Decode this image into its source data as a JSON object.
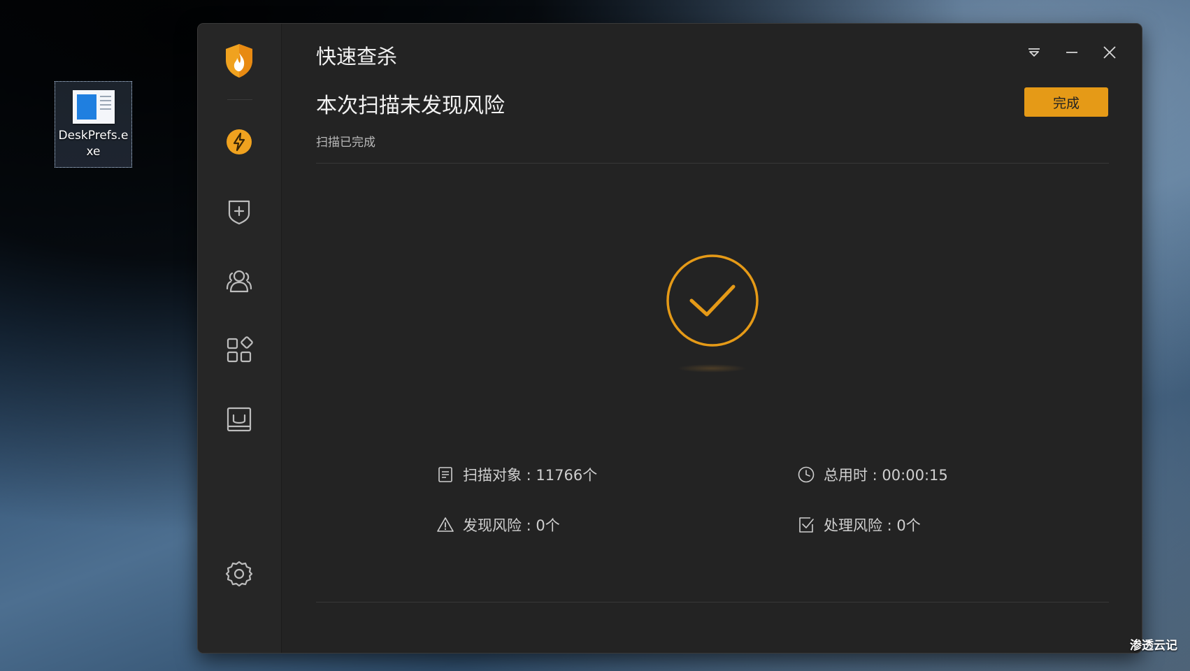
{
  "desktop": {
    "icon_label": "DeskPrefs.exe"
  },
  "window": {
    "title": "快速查杀",
    "headline": "本次扫描未发现风险",
    "subtext": "扫描已完成",
    "done_button": "完成",
    "stats": {
      "scan_objects": "扫描对象 : 11766个",
      "total_time": "总用时 : 00:00:15",
      "risks_found": "发现风险 : 0个",
      "risks_handled": "处理风险 : 0个"
    }
  },
  "sidebar": {
    "items": [
      {
        "name": "quick-scan",
        "icon": "lightning-icon"
      },
      {
        "name": "protection",
        "icon": "shield-plus-icon"
      },
      {
        "name": "accounts",
        "icon": "users-icon"
      },
      {
        "name": "tools",
        "icon": "apps-grid-icon"
      },
      {
        "name": "quarantine",
        "icon": "tray-icon"
      },
      {
        "name": "settings",
        "icon": "gear-icon"
      }
    ]
  },
  "colors": {
    "accent": "#e59a17",
    "window_bg": "#232323",
    "sidebar_bg": "#262626"
  },
  "watermark": "渗透云记"
}
